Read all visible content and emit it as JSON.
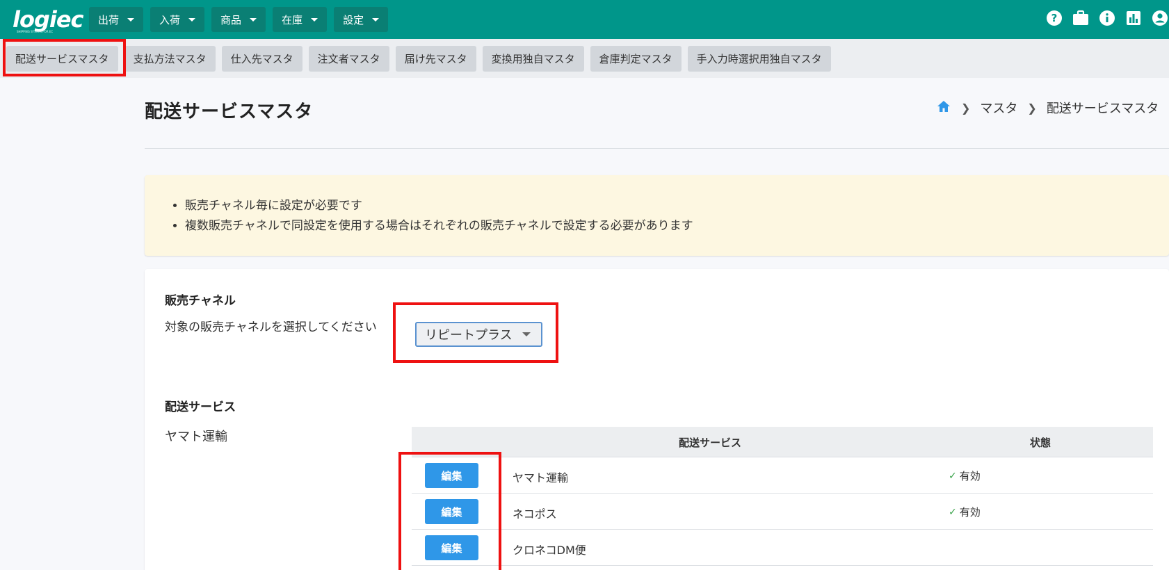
{
  "app": {
    "logo_text": "logiec",
    "logo_tagline": "SHIPPING SYSTEM FOR EC"
  },
  "nav": {
    "menu": [
      {
        "label": "出荷"
      },
      {
        "label": "入荷"
      },
      {
        "label": "商品"
      },
      {
        "label": "在庫"
      },
      {
        "label": "設定"
      }
    ],
    "icons": [
      "help-icon",
      "briefcase-icon",
      "info-icon",
      "chart-icon",
      "account-icon"
    ]
  },
  "sub_tabs": [
    {
      "label": "配送サービスマスタ",
      "active": true
    },
    {
      "label": "支払方法マスタ"
    },
    {
      "label": "仕入先マスタ"
    },
    {
      "label": "注文者マスタ"
    },
    {
      "label": "届け先マスタ"
    },
    {
      "label": "変換用独自マスタ"
    },
    {
      "label": "倉庫判定マスタ"
    },
    {
      "label": "手入力時選択用独自マスタ"
    }
  ],
  "page": {
    "title": "配送サービスマスタ",
    "breadcrumb": {
      "home_icon": "home-icon",
      "items": [
        "マスタ",
        "配送サービスマスタ"
      ]
    }
  },
  "notice": {
    "items": [
      "販売チャネル毎に設定が必要です",
      "複数販売チャネルで同設定を使用する場合はそれぞれの販売チャネルで設定する必要があります"
    ]
  },
  "channel_section": {
    "heading": "販売チャネル",
    "label": "対象の販売チャネルを選択してください",
    "selected": "リピートプラス"
  },
  "service_section": {
    "heading": "配送サービス",
    "carrier": "ヤマト運輸",
    "columns": {
      "service": "配送サービス",
      "status": "状態"
    },
    "rows": [
      {
        "edit": "編集",
        "service": "ヤマト運輸",
        "status": "有効"
      },
      {
        "edit": "編集",
        "service": "ネコポス",
        "status": "有効"
      },
      {
        "edit": "編集",
        "service": "クロネコDM便",
        "status": ""
      }
    ]
  },
  "colors": {
    "header_bg": "#00968a",
    "primary_button": "#2f97e8",
    "highlight": "#ee1111",
    "notice_bg": "#fdf7e1"
  }
}
